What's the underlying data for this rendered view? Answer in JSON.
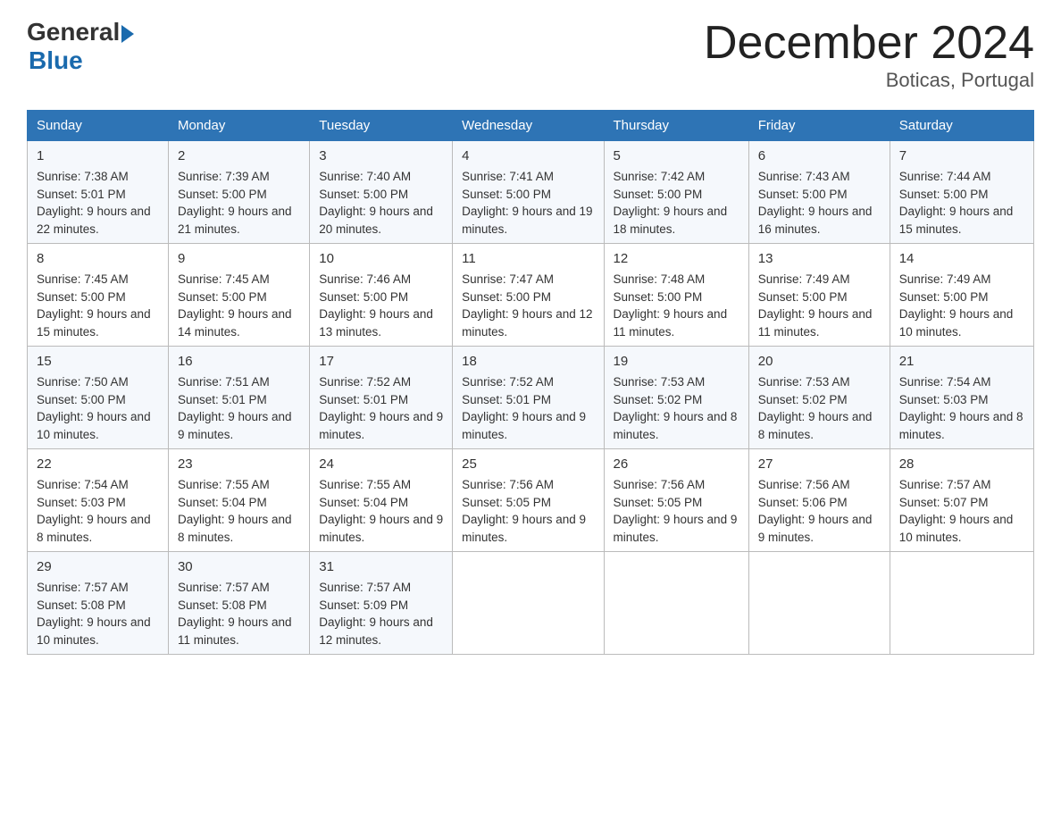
{
  "header": {
    "logo": {
      "general": "General",
      "arrow": "▶",
      "blue": "Blue"
    },
    "title": "December 2024",
    "subtitle": "Boticas, Portugal"
  },
  "days": [
    "Sunday",
    "Monday",
    "Tuesday",
    "Wednesday",
    "Thursday",
    "Friday",
    "Saturday"
  ],
  "weeks": [
    [
      {
        "day": "1",
        "sunrise": "7:38 AM",
        "sunset": "5:01 PM",
        "daylight": "9 hours and 22 minutes."
      },
      {
        "day": "2",
        "sunrise": "7:39 AM",
        "sunset": "5:00 PM",
        "daylight": "9 hours and 21 minutes."
      },
      {
        "day": "3",
        "sunrise": "7:40 AM",
        "sunset": "5:00 PM",
        "daylight": "9 hours and 20 minutes."
      },
      {
        "day": "4",
        "sunrise": "7:41 AM",
        "sunset": "5:00 PM",
        "daylight": "9 hours and 19 minutes."
      },
      {
        "day": "5",
        "sunrise": "7:42 AM",
        "sunset": "5:00 PM",
        "daylight": "9 hours and 18 minutes."
      },
      {
        "day": "6",
        "sunrise": "7:43 AM",
        "sunset": "5:00 PM",
        "daylight": "9 hours and 16 minutes."
      },
      {
        "day": "7",
        "sunrise": "7:44 AM",
        "sunset": "5:00 PM",
        "daylight": "9 hours and 15 minutes."
      }
    ],
    [
      {
        "day": "8",
        "sunrise": "7:45 AM",
        "sunset": "5:00 PM",
        "daylight": "9 hours and 15 minutes."
      },
      {
        "day": "9",
        "sunrise": "7:45 AM",
        "sunset": "5:00 PM",
        "daylight": "9 hours and 14 minutes."
      },
      {
        "day": "10",
        "sunrise": "7:46 AM",
        "sunset": "5:00 PM",
        "daylight": "9 hours and 13 minutes."
      },
      {
        "day": "11",
        "sunrise": "7:47 AM",
        "sunset": "5:00 PM",
        "daylight": "9 hours and 12 minutes."
      },
      {
        "day": "12",
        "sunrise": "7:48 AM",
        "sunset": "5:00 PM",
        "daylight": "9 hours and 11 minutes."
      },
      {
        "day": "13",
        "sunrise": "7:49 AM",
        "sunset": "5:00 PM",
        "daylight": "9 hours and 11 minutes."
      },
      {
        "day": "14",
        "sunrise": "7:49 AM",
        "sunset": "5:00 PM",
        "daylight": "9 hours and 10 minutes."
      }
    ],
    [
      {
        "day": "15",
        "sunrise": "7:50 AM",
        "sunset": "5:00 PM",
        "daylight": "9 hours and 10 minutes."
      },
      {
        "day": "16",
        "sunrise": "7:51 AM",
        "sunset": "5:01 PM",
        "daylight": "9 hours and 9 minutes."
      },
      {
        "day": "17",
        "sunrise": "7:52 AM",
        "sunset": "5:01 PM",
        "daylight": "9 hours and 9 minutes."
      },
      {
        "day": "18",
        "sunrise": "7:52 AM",
        "sunset": "5:01 PM",
        "daylight": "9 hours and 9 minutes."
      },
      {
        "day": "19",
        "sunrise": "7:53 AM",
        "sunset": "5:02 PM",
        "daylight": "9 hours and 8 minutes."
      },
      {
        "day": "20",
        "sunrise": "7:53 AM",
        "sunset": "5:02 PM",
        "daylight": "9 hours and 8 minutes."
      },
      {
        "day": "21",
        "sunrise": "7:54 AM",
        "sunset": "5:03 PM",
        "daylight": "9 hours and 8 minutes."
      }
    ],
    [
      {
        "day": "22",
        "sunrise": "7:54 AM",
        "sunset": "5:03 PM",
        "daylight": "9 hours and 8 minutes."
      },
      {
        "day": "23",
        "sunrise": "7:55 AM",
        "sunset": "5:04 PM",
        "daylight": "9 hours and 8 minutes."
      },
      {
        "day": "24",
        "sunrise": "7:55 AM",
        "sunset": "5:04 PM",
        "daylight": "9 hours and 9 minutes."
      },
      {
        "day": "25",
        "sunrise": "7:56 AM",
        "sunset": "5:05 PM",
        "daylight": "9 hours and 9 minutes."
      },
      {
        "day": "26",
        "sunrise": "7:56 AM",
        "sunset": "5:05 PM",
        "daylight": "9 hours and 9 minutes."
      },
      {
        "day": "27",
        "sunrise": "7:56 AM",
        "sunset": "5:06 PM",
        "daylight": "9 hours and 9 minutes."
      },
      {
        "day": "28",
        "sunrise": "7:57 AM",
        "sunset": "5:07 PM",
        "daylight": "9 hours and 10 minutes."
      }
    ],
    [
      {
        "day": "29",
        "sunrise": "7:57 AM",
        "sunset": "5:08 PM",
        "daylight": "9 hours and 10 minutes."
      },
      {
        "day": "30",
        "sunrise": "7:57 AM",
        "sunset": "5:08 PM",
        "daylight": "9 hours and 11 minutes."
      },
      {
        "day": "31",
        "sunrise": "7:57 AM",
        "sunset": "5:09 PM",
        "daylight": "9 hours and 12 minutes."
      },
      null,
      null,
      null,
      null
    ]
  ],
  "labels": {
    "sunrise": "Sunrise:",
    "sunset": "Sunset:",
    "daylight": "Daylight:"
  }
}
